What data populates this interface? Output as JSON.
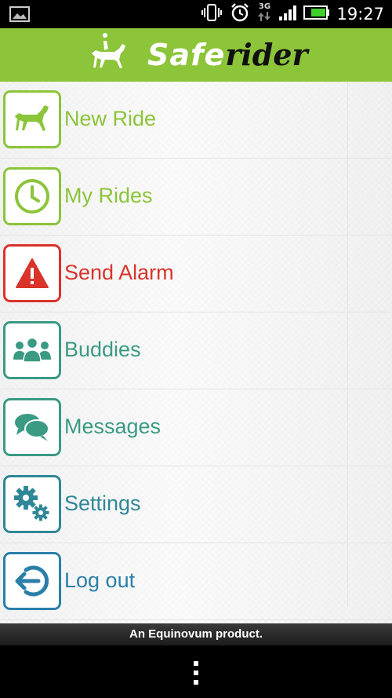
{
  "status_bar": {
    "time": "19:27",
    "network": "3G",
    "icons": [
      "image-notification-icon",
      "vibrate-icon",
      "alarm-icon",
      "signal-icon",
      "battery-icon"
    ]
  },
  "app_bar": {
    "logo_safe": "Safe",
    "logo_rider": "rider",
    "color": "#8cc43a"
  },
  "menu": {
    "items": [
      {
        "label": "New Ride",
        "color": "#8cc43a",
        "icon": "horse-icon"
      },
      {
        "label": "My Rides",
        "color": "#8cc43a",
        "icon": "clock-icon"
      },
      {
        "label": "Send Alarm",
        "color": "#d9342b",
        "icon": "warning-icon"
      },
      {
        "label": "Buddies",
        "color": "#3a9a84",
        "icon": "group-icon"
      },
      {
        "label": "Messages",
        "color": "#3a9a84",
        "icon": "chat-icon"
      },
      {
        "label": "Settings",
        "color": "#2f8798",
        "icon": "gears-icon"
      },
      {
        "label": "Log out",
        "color": "#2a7fa8",
        "icon": "logout-icon"
      }
    ]
  },
  "footer": {
    "text": "An Equinovum product."
  }
}
